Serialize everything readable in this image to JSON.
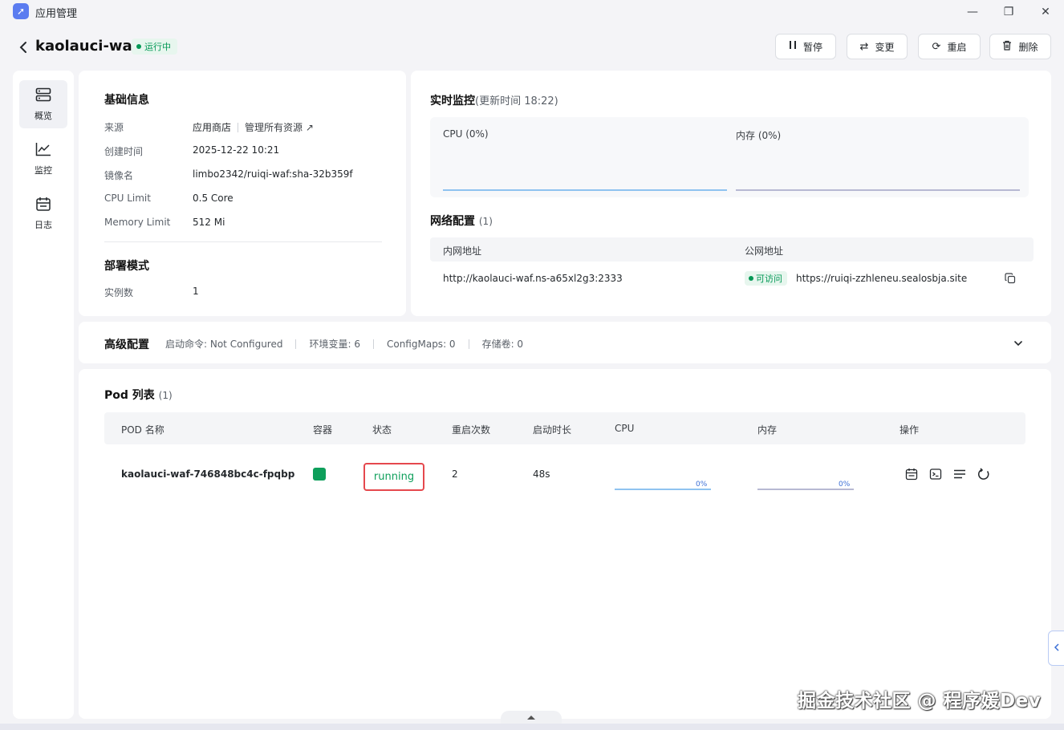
{
  "window": {
    "app_title": "应用管理",
    "minimize_glyph": "—",
    "maximize_glyph": "❐",
    "close_glyph": "✕"
  },
  "header": {
    "app_name": "kaolauci-waf",
    "status": "运行中",
    "buttons": {
      "pause": "暂停",
      "change": "变更",
      "restart": "重启",
      "delete": "删除"
    }
  },
  "sidebar": {
    "items": [
      {
        "label": "概览",
        "icon": "server-icon"
      },
      {
        "label": "监控",
        "icon": "chart-line-icon"
      },
      {
        "label": "日志",
        "icon": "calendar-icon"
      }
    ]
  },
  "basic_info": {
    "title": "基础信息",
    "rows": [
      {
        "key": "来源",
        "value": "应用商店"
      },
      {
        "key": "创建时间",
        "value": "2025-12-22 10:21"
      },
      {
        "key": "镜像名",
        "value": "limbo2342/ruiqi-waf:sha-32b359f"
      },
      {
        "key": "CPU Limit",
        "value": "0.5 Core"
      },
      {
        "key": "Memory Limit",
        "value": "512 Mi"
      }
    ],
    "manage_link": "管理所有资源"
  },
  "deploy": {
    "title": "部署模式",
    "instances_key": "实例数",
    "instances_value": "1"
  },
  "monitor": {
    "title": "实时监控",
    "update_time": "(更新时间 18:22)",
    "cpu_label": "CPU (0%)",
    "mem_label": "内存 (0%)",
    "colors": {
      "cpu": "#8fc3f0",
      "mem": "#b7b9d3"
    }
  },
  "network": {
    "title": "网络配置",
    "count": "(1)",
    "col_internal": "内网地址",
    "col_public": "公网地址",
    "internal_address": "http://kaolauci-waf.ns-a65xl2g3:2333",
    "access_badge": "可访问",
    "public_address": "https://ruiqi-zzhleneu.sealosbja.site"
  },
  "advanced": {
    "title": "高级配置",
    "items": [
      "启动命令: Not Configured",
      "环境变量: 6",
      "ConfigMaps: 0",
      "存储卷: 0"
    ]
  },
  "pods": {
    "title": "Pod 列表",
    "count": "(1)",
    "columns": [
      "POD 名称",
      "容器",
      "状态",
      "重启次数",
      "启动时长",
      "CPU",
      "内存",
      "操作"
    ],
    "rows": [
      {
        "name": "kaolauci-waf-746848bc4c-fpqbp",
        "status": "running",
        "restarts": "2",
        "uptime": "48s",
        "cpu_pct": "0%",
        "mem_pct": "0%"
      }
    ],
    "colors": {
      "container": "#0e9f5b",
      "status_text": "#0e9f5b",
      "highlight": "#e5484d"
    }
  },
  "watermark": "掘金技术社区 @ 程序媛Dev"
}
